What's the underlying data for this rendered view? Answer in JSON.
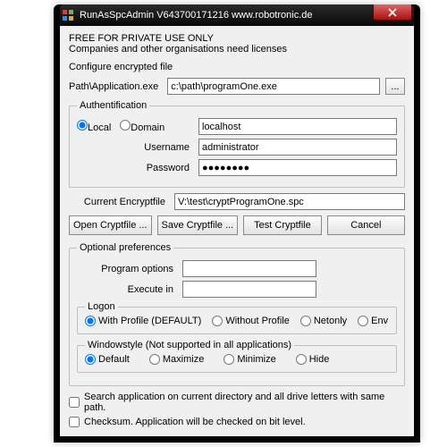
{
  "title": "RunAsSpcAdmin V643700171216 www.robotronic.de",
  "free_header": "FREE FOR PRIVATE USE ONLY",
  "free_sub": "Companies and other organisations need licenses",
  "configure_label": "Configure encrypted file",
  "path_label": "Path\\Application.exe",
  "path_value": "c:\\path\\programOne.exe",
  "browse_label": "...",
  "auth": {
    "legend": "Authentification",
    "local": "Local",
    "domain": "Domain",
    "domain_value": "localhost",
    "username_label": "Username",
    "username_value": "administrator",
    "password_label": "Password",
    "password_value": "●●●●●●●●"
  },
  "cryptfile_label": "Current Encryptfile",
  "cryptfile_value": "V:\\test\\cryptProgramOne.spc",
  "buttons": {
    "open": "Open Cryptfile ...",
    "save": "Save Cryptfile ...",
    "test": "Test Cryptfile",
    "cancel": "Cancel"
  },
  "pref": {
    "legend": "Optional preferences",
    "program_options": "Program options",
    "execute_in": "Execute in"
  },
  "logon": {
    "legend": "Logon",
    "with_profile": "With Profile (DEFAULT)",
    "without_profile": "Without Profile",
    "netonly": "Netonly",
    "env": "Env"
  },
  "winstyle": {
    "legend": "Windowstyle (Not supported in all applications)",
    "default": "Default",
    "maximize": "Maximize",
    "minimize": "Minimize",
    "hide": "Hide"
  },
  "search_label": "Search application on current directory and all drive letters with same path.",
  "checksum_label": "Checksum. Application will be checked on bit level."
}
